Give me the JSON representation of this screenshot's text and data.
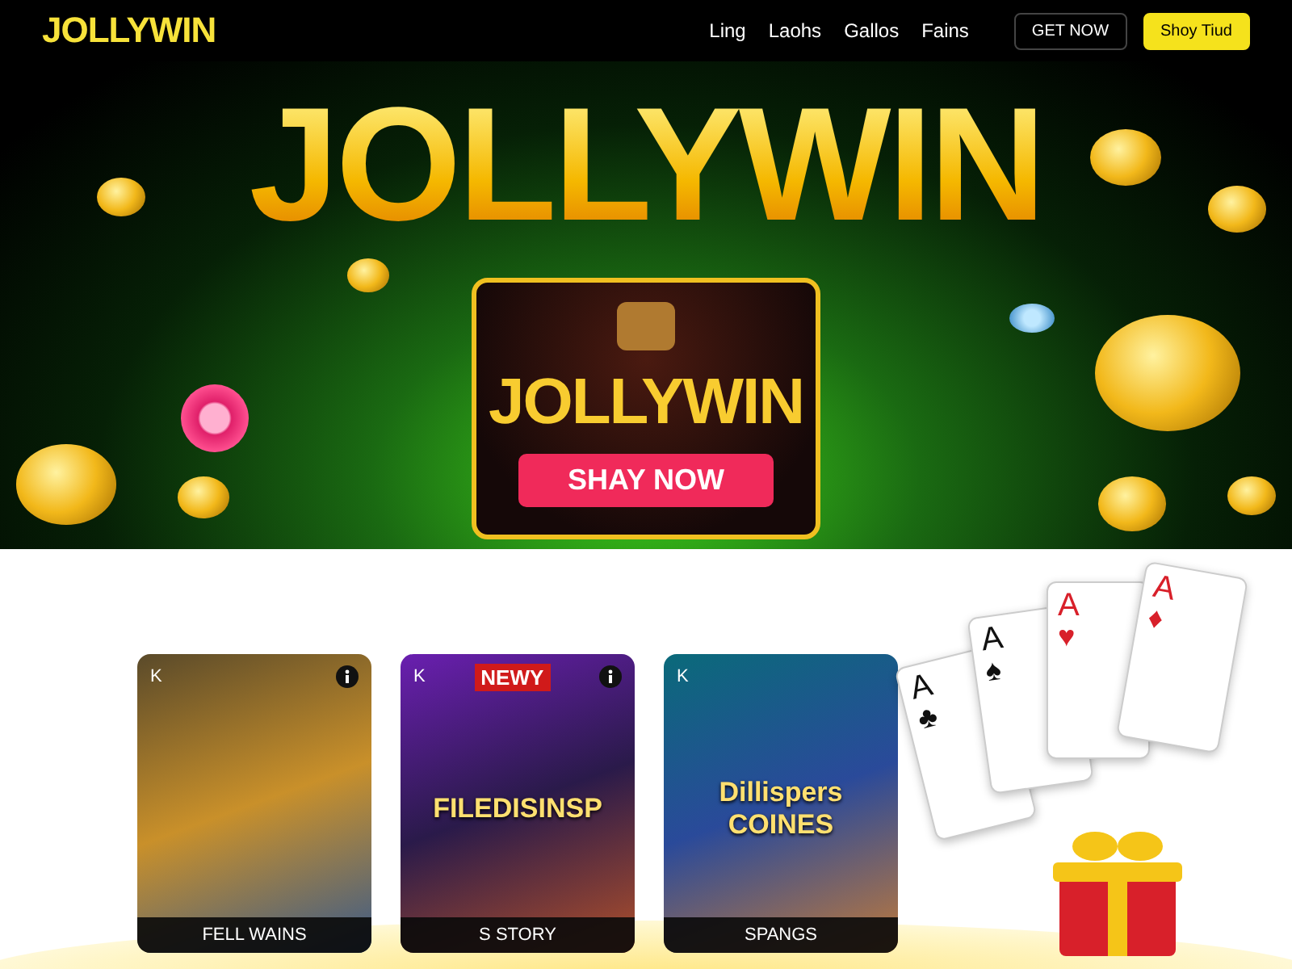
{
  "nav": {
    "logo": "JOLLYWIN",
    "links": [
      "Ling",
      "Laohs",
      "Gallos",
      "Fains"
    ],
    "buttons": [
      {
        "label": "GET NOW",
        "kind": "outline"
      },
      {
        "label": "Shoy Tiud",
        "kind": "filled"
      }
    ]
  },
  "hero": {
    "title": "JOLLYWIN",
    "banner": {
      "title": "JOLLYWIN",
      "button": "SHAY NOW"
    }
  },
  "games": [
    {
      "corner": "K",
      "info_icon": true,
      "caption": "FELL WAINS"
    },
    {
      "corner": "K",
      "info_icon": true,
      "badge": "NEWY",
      "art_title": "FILEDISINSP",
      "caption": "S STORY"
    },
    {
      "corner": "K",
      "info_icon": false,
      "art_title": "Dillispers COINES",
      "caption": "SPANGS"
    }
  ],
  "playing_cards": [
    {
      "rank": "A",
      "suit": "♣",
      "red": false
    },
    {
      "rank": "A",
      "suit": "♠",
      "red": false
    },
    {
      "rank": "A",
      "suit": "♥",
      "red": true
    },
    {
      "rank": "A",
      "suit": "♦",
      "red": true
    }
  ]
}
